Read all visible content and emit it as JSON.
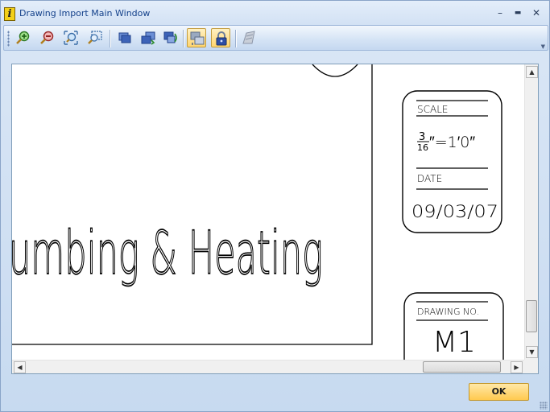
{
  "window": {
    "title": "Drawing Import Main Window",
    "app_icon_letter": "i",
    "minimize_glyph": "–",
    "maximize_glyph": "▬",
    "close_glyph": "✕"
  },
  "toolbar": {
    "buttons": [
      {
        "name": "zoom-in",
        "icon": "zoom-in-icon",
        "active": false
      },
      {
        "name": "zoom-out",
        "icon": "zoom-out-icon",
        "active": false
      },
      {
        "name": "zoom-extents",
        "icon": "zoom-extents-icon",
        "active": false
      },
      {
        "name": "zoom-window",
        "icon": "zoom-window-icon",
        "active": false
      },
      {
        "name": "layers",
        "icon": "layers-icon",
        "active": false
      },
      {
        "name": "layer-forward",
        "icon": "layer-forward-icon",
        "active": false
      },
      {
        "name": "layer-back",
        "icon": "layer-back-icon",
        "active": false
      },
      {
        "name": "overlay",
        "icon": "overlay-icon",
        "active": true
      },
      {
        "name": "lock",
        "icon": "lock-icon",
        "active": true
      },
      {
        "name": "export",
        "icon": "export-icon",
        "active": false
      }
    ]
  },
  "drawing": {
    "title_text": "umbing & Heating",
    "scale_label": "SCALE",
    "scale_fraction_num": "3",
    "scale_fraction_den": "16",
    "scale_value": "″=1′0″",
    "date_label": "DATE",
    "date_value": "09/03/07",
    "drawing_no_label": "DRAWING NO.",
    "drawing_no_value": "M1"
  },
  "footer": {
    "ok_label": "OK"
  },
  "colors": {
    "title_text": "#15428b",
    "ok_button": "#ffc94f",
    "active_tool": "#ffd56e"
  }
}
